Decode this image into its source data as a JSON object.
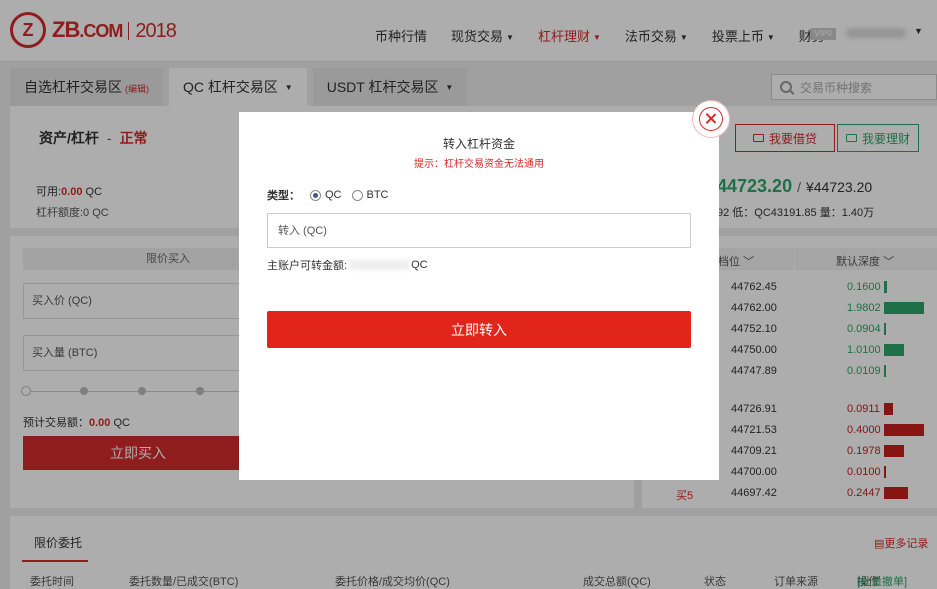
{
  "header": {
    "logo": {
      "mark": "Z",
      "brand": "ZB",
      "domain": ".COM",
      "year": "2018"
    },
    "nav": [
      {
        "label": "币种行情",
        "caret": false,
        "active": false
      },
      {
        "label": "现货交易",
        "caret": true,
        "active": false
      },
      {
        "label": "杠杆理财",
        "caret": true,
        "active": true
      },
      {
        "label": "法币交易",
        "caret": true,
        "active": false
      },
      {
        "label": "投票上币",
        "caret": true,
        "active": false
      },
      {
        "label": "财务",
        "caret": true,
        "active": false
      }
    ],
    "vip": "VIP0"
  },
  "tabs": {
    "custom": "自选杠杆交易区",
    "custom_edit": "(编辑)",
    "qc": "QC 杠杆交易区",
    "usdt": "USDT 杠杆交易区"
  },
  "search": {
    "placeholder": "交易币种搜索"
  },
  "asset": {
    "title": "资产/杠杆",
    "dash": "-",
    "status": "正常",
    "available_label": "可用:",
    "available_value": "0.00",
    "available_unit": "QC",
    "limit": "杠杆额度:0 QC",
    "borrow_button": "我要借贷",
    "invest_button": "我要理财",
    "price": "44723.20",
    "price_sep": "/",
    "price_cny": "¥44723.20",
    "stats": "92   低：QC43191.85   量：1.40万"
  },
  "trade": {
    "tab": "限价买入",
    "price_input": "买入价 (QC)",
    "amount_input": "买入量 (BTC)",
    "est_label": "预计交易额：",
    "est_value": "0.00",
    "est_unit": "QC",
    "buy_button": "立即买入"
  },
  "book": {
    "head_left": "档位",
    "head_right": "默认深度",
    "asks": [
      {
        "price": "44762.45",
        "amount": "0.1600",
        "depth": 0.08
      },
      {
        "price": "44762.00",
        "amount": "1.9802",
        "depth": 1.0
      },
      {
        "price": "44752.10",
        "amount": "0.0904",
        "depth": 0.05
      },
      {
        "price": "44750.00",
        "amount": "1.0100",
        "depth": 0.51
      },
      {
        "price": "44747.89",
        "amount": "0.0109",
        "depth": 0.02
      }
    ],
    "bids": [
      {
        "label": "",
        "price": "44726.91",
        "amount": "0.0911",
        "depth": 0.23
      },
      {
        "label": "",
        "price": "44721.53",
        "amount": "0.4000",
        "depth": 1.0
      },
      {
        "label": "",
        "price": "44709.21",
        "amount": "0.1978",
        "depth": 0.49
      },
      {
        "label": "",
        "price": "44700.00",
        "amount": "0.0100",
        "depth": 0.03
      },
      {
        "label": "买5",
        "price": "44697.42",
        "amount": "0.2447",
        "depth": 0.61
      }
    ],
    "ask_color": "#2fa46a",
    "bid_color": "#c7201e"
  },
  "orders": {
    "tab": "限价委托",
    "more": "更多记录",
    "columns": {
      "time": "委托时间",
      "qty": "委托数量/已成交(BTC)",
      "price": "委托价格/成交均价(QC)",
      "total": "成交总额(QC)",
      "status": "状态",
      "source": "订单来源",
      "action": "操作",
      "batch": "[批量撤单]"
    }
  },
  "modal": {
    "title": "转入杠杆资金",
    "tip": "提示：杠杆交易资金无法通用",
    "type_label": "类型：",
    "options": [
      "QC",
      "BTC"
    ],
    "selected": "QC",
    "input_placeholder": "转入 (QC)",
    "available_label": "主账户可转金额:",
    "available_unit": "QC",
    "submit_button": "立即转入"
  },
  "colors": {
    "brand_red": "#d32b2b",
    "green": "#2fa46a",
    "button_red": "#e1251b"
  }
}
